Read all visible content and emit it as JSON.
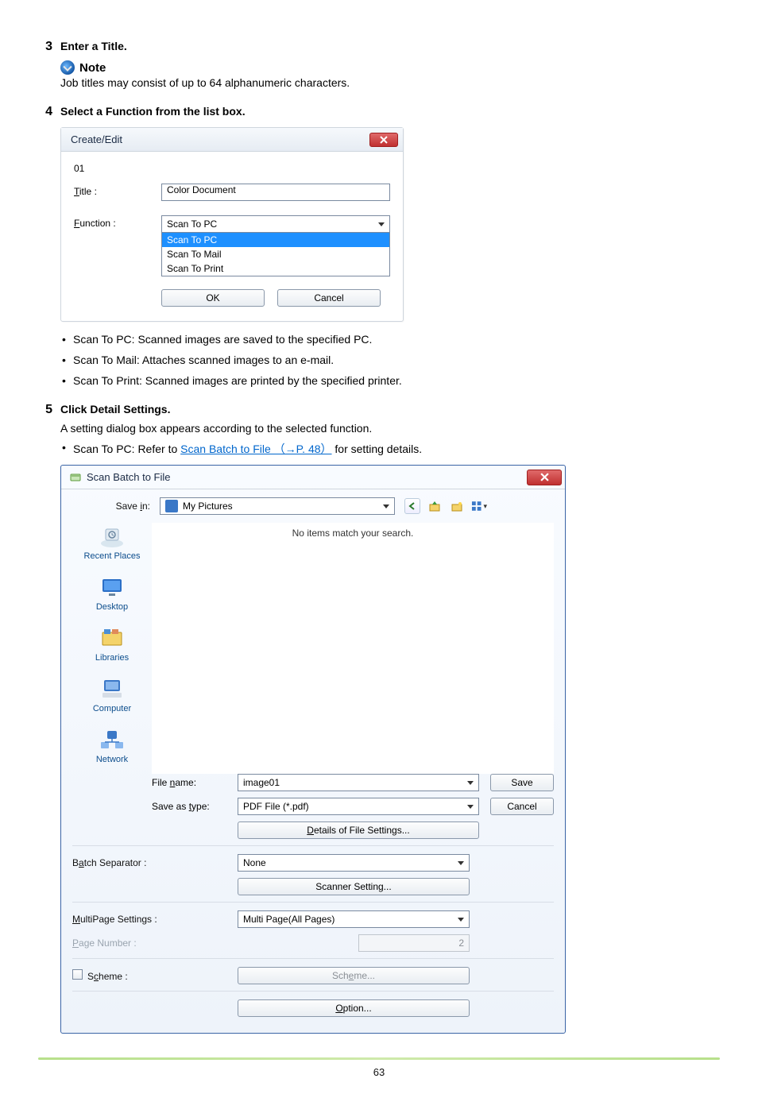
{
  "steps": {
    "s3": {
      "num": "3",
      "title": "Enter a Title."
    },
    "s4": {
      "num": "4",
      "title": "Select a Function from the list box."
    },
    "s5": {
      "num": "5",
      "title": "Click Detail Settings."
    }
  },
  "note": {
    "label": "Note",
    "body": "Job titles may consist of up to 64 alphanumeric characters."
  },
  "dlg1": {
    "title": "Create/Edit",
    "jobNo": "01",
    "titleLabel": "Title :",
    "titleU": "T",
    "titleValue": "Color Document",
    "funcLabel": "Function :",
    "funcU": "F",
    "funcValue": "Scan To PC",
    "options": {
      "o1": "Scan To PC",
      "o2": "Scan To Mail",
      "o3": "Scan To Print"
    },
    "ok": "OK",
    "cancel": "Cancel"
  },
  "bullets": {
    "b1": "Scan To PC: Scanned images are saved to the specified PC.",
    "b2": "Scan To Mail: Attaches scanned images to an e-mail.",
    "b3": "Scan To Print: Scanned images are printed by the specified printer."
  },
  "step5": {
    "body": "A setting dialog box appears according to the selected function.",
    "bulletPrefix": "Scan To PC: Refer to ",
    "link": "Scan Batch to File （→P. 48）",
    "bulletSuffix": " for setting details."
  },
  "dlg2": {
    "title": "Scan Batch to File",
    "saveIn": {
      "label": "Save in:",
      "u": "i",
      "value": "My Pictures"
    },
    "emptyMsg": "No items match your search.",
    "places": {
      "recent": "Recent Places",
      "desktop": "Desktop",
      "libraries": "Libraries",
      "computer": "Computer",
      "network": "Network"
    },
    "fileName": {
      "label": "File name:",
      "u": "n",
      "value": "image01"
    },
    "saveAs": {
      "label": "Save as type:",
      "u": "t",
      "value": "PDF File (*.pdf)"
    },
    "detailsBtn": {
      "text": "Details of File Settings...",
      "u": "D"
    },
    "batchSep": {
      "label": "Batch Separator :",
      "u": "a",
      "value": "None"
    },
    "scannerBtn": "Scanner Setting...",
    "multiPage": {
      "label": "MultiPage Settings :",
      "u": "M",
      "value": "Multi Page(All Pages)"
    },
    "pageNum": {
      "label": "Page Number :",
      "u": "P",
      "value": "2"
    },
    "scheme": {
      "label": "Scheme :",
      "u": "c",
      "btn": "Scheme...",
      "btnU": "e"
    },
    "optionBtn": {
      "text": "Option...",
      "u": "O"
    },
    "save": "Save",
    "cancel": "Cancel"
  },
  "pageNumber": "63"
}
